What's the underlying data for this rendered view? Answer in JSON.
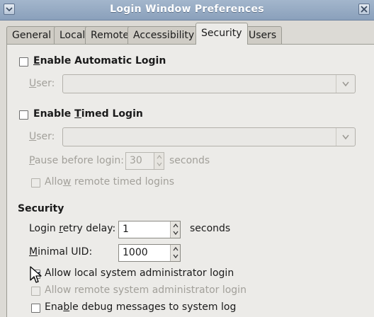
{
  "window": {
    "title": "Login Window Preferences"
  },
  "tabs": [
    {
      "label": "General"
    },
    {
      "label": "Local"
    },
    {
      "label": "Remote"
    },
    {
      "label": "Accessibility"
    },
    {
      "label": "Security",
      "active": true
    },
    {
      "label": "Users"
    }
  ],
  "auto_login": {
    "checkbox_label_pre": "",
    "checkbox_mnemonic": "E",
    "checkbox_label_post": "nable Automatic Login",
    "checked": false,
    "user_label_mnemonic": "U",
    "user_label_post": "ser:",
    "user_value": ""
  },
  "timed_login": {
    "checkbox_label_pre": "Enable ",
    "checkbox_mnemonic": "T",
    "checkbox_label_post": "imed Login",
    "checked": false,
    "user_label_mnemonic": "U",
    "user_label_post": "ser:",
    "user_value": "",
    "pause_mnemonic": "P",
    "pause_label_post": "ause before login:",
    "pause_value": "30",
    "pause_unit": "seconds",
    "remote_label_pre": "Allo",
    "remote_mnemonic": "w",
    "remote_label_post": " remote timed logins",
    "remote_checked": false
  },
  "security": {
    "heading": "Security",
    "retry_label_pre": "Login ",
    "retry_mnemonic": "r",
    "retry_label_post": "etry delay:",
    "retry_value": "1",
    "retry_unit": "seconds",
    "uid_mnemonic": "M",
    "uid_label_post": "inimal UID:",
    "uid_value": "1000",
    "allow_local_admin_label": "Allow local system administrator login",
    "allow_local_admin_checked": true,
    "allow_remote_admin_label": "Allow remote system administrator login",
    "allow_remote_admin_checked": false,
    "debug_label_pre": "Ena",
    "debug_mnemonic": "b",
    "debug_label_post": "le debug messages to system log",
    "debug_checked": false
  },
  "colors": {
    "titlebar": "#8aa0bb",
    "panel": "#ecebe8",
    "disabled_text": "#a2a09a"
  }
}
